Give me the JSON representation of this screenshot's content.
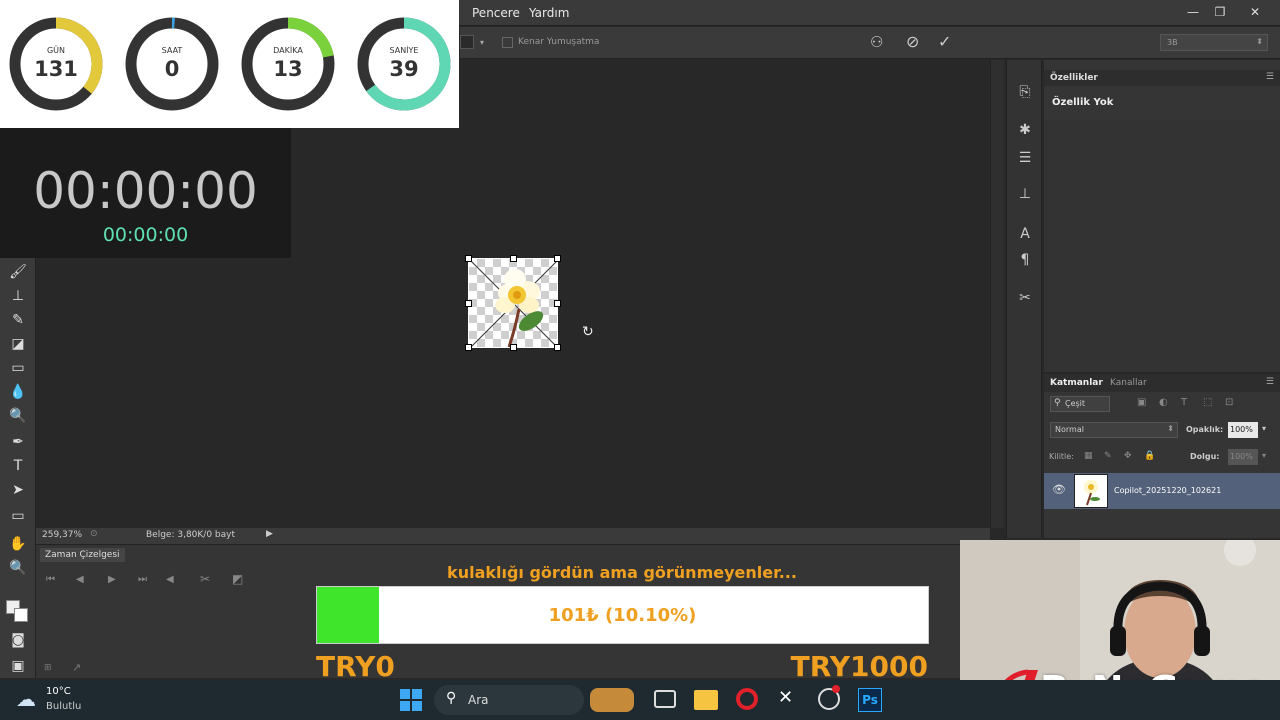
{
  "menubar": {
    "items": [
      "Pencere",
      "Yardım"
    ]
  },
  "options": {
    "feather_label": "Kenar Yumuşatma",
    "workspace": "3B"
  },
  "widget": {
    "gauges": [
      {
        "label": "GÜN",
        "value": "131",
        "fraction": 0.36,
        "color": "#e2c93c"
      },
      {
        "label": "SAAT",
        "value": "0",
        "fraction": 0.01,
        "color": "#3aa0e0"
      },
      {
        "label": "DAKİKA",
        "value": "13",
        "fraction": 0.22,
        "color": "#7ad13c"
      },
      {
        "label": "SANİYE",
        "value": "39",
        "fraction": 0.65,
        "color": "#5fd7b5"
      }
    ]
  },
  "timer": {
    "main": "00:00:00",
    "sub": "00:00:00"
  },
  "status": {
    "zoom": "259,37%",
    "doc": "Belge: 3,80K/0 bayt"
  },
  "timeline": {
    "tab": "Zaman Çizelgesi"
  },
  "properties": {
    "tab": "Özellikler",
    "empty": "Özellik Yok"
  },
  "layers": {
    "tabs": [
      "Katmanlar",
      "Kanallar"
    ],
    "filter": "Çeşit",
    "blend": "Normal",
    "opacity_label": "Opaklık:",
    "opacity": "100%",
    "lock_label": "Kilitle:",
    "fill_label": "Dolgu:",
    "fill": "100%",
    "layer_name": "Copilot_20251220_102621"
  },
  "donation": {
    "message": "kulaklığı gördün ama görünmeyenler...",
    "progress_text": "101₺ (10.10%)",
    "progress": 0.101,
    "min": "TRY0",
    "max": "TRY1000"
  },
  "taskbar": {
    "temp": "10°C",
    "weather": "Bulutlu",
    "search": "Ara"
  },
  "watermark": {
    "brand": "ByNoGame"
  }
}
